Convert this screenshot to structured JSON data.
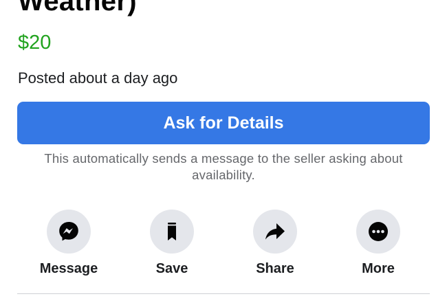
{
  "listing": {
    "title": "Weather)",
    "price": "$20",
    "posted": "Posted about a day ago"
  },
  "cta": {
    "label": "Ask for Details",
    "note": "This automatically sends a message to the seller asking about availability."
  },
  "actions": [
    {
      "label": "Message",
      "icon": "messenger-icon"
    },
    {
      "label": "Save",
      "icon": "bookmark-icon"
    },
    {
      "label": "Share",
      "icon": "share-arrow-icon"
    },
    {
      "label": "More",
      "icon": "more-dots-icon"
    }
  ],
  "colors": {
    "price": "#22a31f",
    "button": "#3578e5",
    "icon_bg": "#e4e6eb",
    "secondary_text": "#65676b"
  }
}
